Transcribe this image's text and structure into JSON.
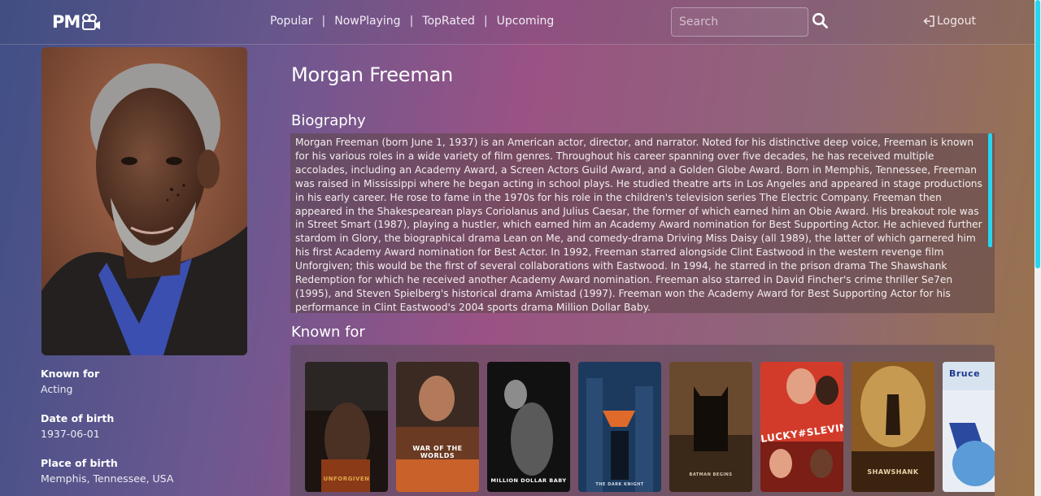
{
  "nav": {
    "brand": "PM",
    "links": [
      "Popular",
      "NowPlaying",
      "TopRated",
      "Upcoming"
    ],
    "search_placeholder": "Search",
    "logout_label": "Logout"
  },
  "person": {
    "name": "Morgan Freeman",
    "known_for_label": "Known for",
    "known_for_value": "Acting",
    "birthday_label": "Date of birth",
    "birthday_value": "1937-06-01",
    "birthplace_label": "Place of birth",
    "birthplace_value": "Memphis, Tennessee, USA"
  },
  "biography": {
    "title": "Biography",
    "text": "Morgan Freeman (born June 1, 1937) is an American actor, director, and narrator. Noted for his distinctive deep voice, Freeman is known for his various roles in a wide variety of film genres. Throughout his career spanning over five decades, he has received multiple accolades, including an Academy Award, a Screen Actors Guild Award, and a Golden Globe Award. Born in Memphis, Tennessee, Freeman was raised in Mississippi where he began acting in school plays. He studied theatre arts in Los Angeles and appeared in stage productions in his early career. He rose to fame in the 1970s for his role in the children's television series The Electric Company. Freeman then appeared in the Shakespearean plays Coriolanus and Julius Caesar, the former of which earned him an Obie Award. His breakout role was in Street Smart (1987), playing a hustler, which earned him an Academy Award nomination for Best Supporting Actor. He achieved further stardom in Glory, the biographical drama Lean on Me, and comedy-drama Driving Miss Daisy (all 1989), the latter of which garnered him his first Academy Award nomination for Best Actor. In 1992, Freeman starred alongside Clint Eastwood in the western revenge film Unforgiven; this would be the first of several collaborations with Eastwood. In 1994, he starred in the prison drama The Shawshank Redemption for which he received another Academy Award nomination. Freeman also starred in David Fincher's crime thriller Se7en (1995), and Steven Spielberg's historical drama Amistad (1997). Freeman won the Academy Award for Best Supporting Actor for his performance in Clint Eastwood's 2004 sports drama Million Dollar Baby."
  },
  "known_for": {
    "title": "Known for",
    "posters": [
      {
        "caption": "UNFORGIVEN"
      },
      {
        "caption": "WAR OF THE WORLDS"
      },
      {
        "caption": "MILLION DOLLAR BABY"
      },
      {
        "caption": "THE DARK KNIGHT"
      },
      {
        "caption": "BATMAN BEGINS"
      },
      {
        "caption": "LUCKY#SLEVIN"
      },
      {
        "caption": "SHAWSHANK"
      },
      {
        "caption": "Bruce"
      }
    ]
  },
  "colors": {
    "accent_scrollbar": "#25d6ee"
  }
}
